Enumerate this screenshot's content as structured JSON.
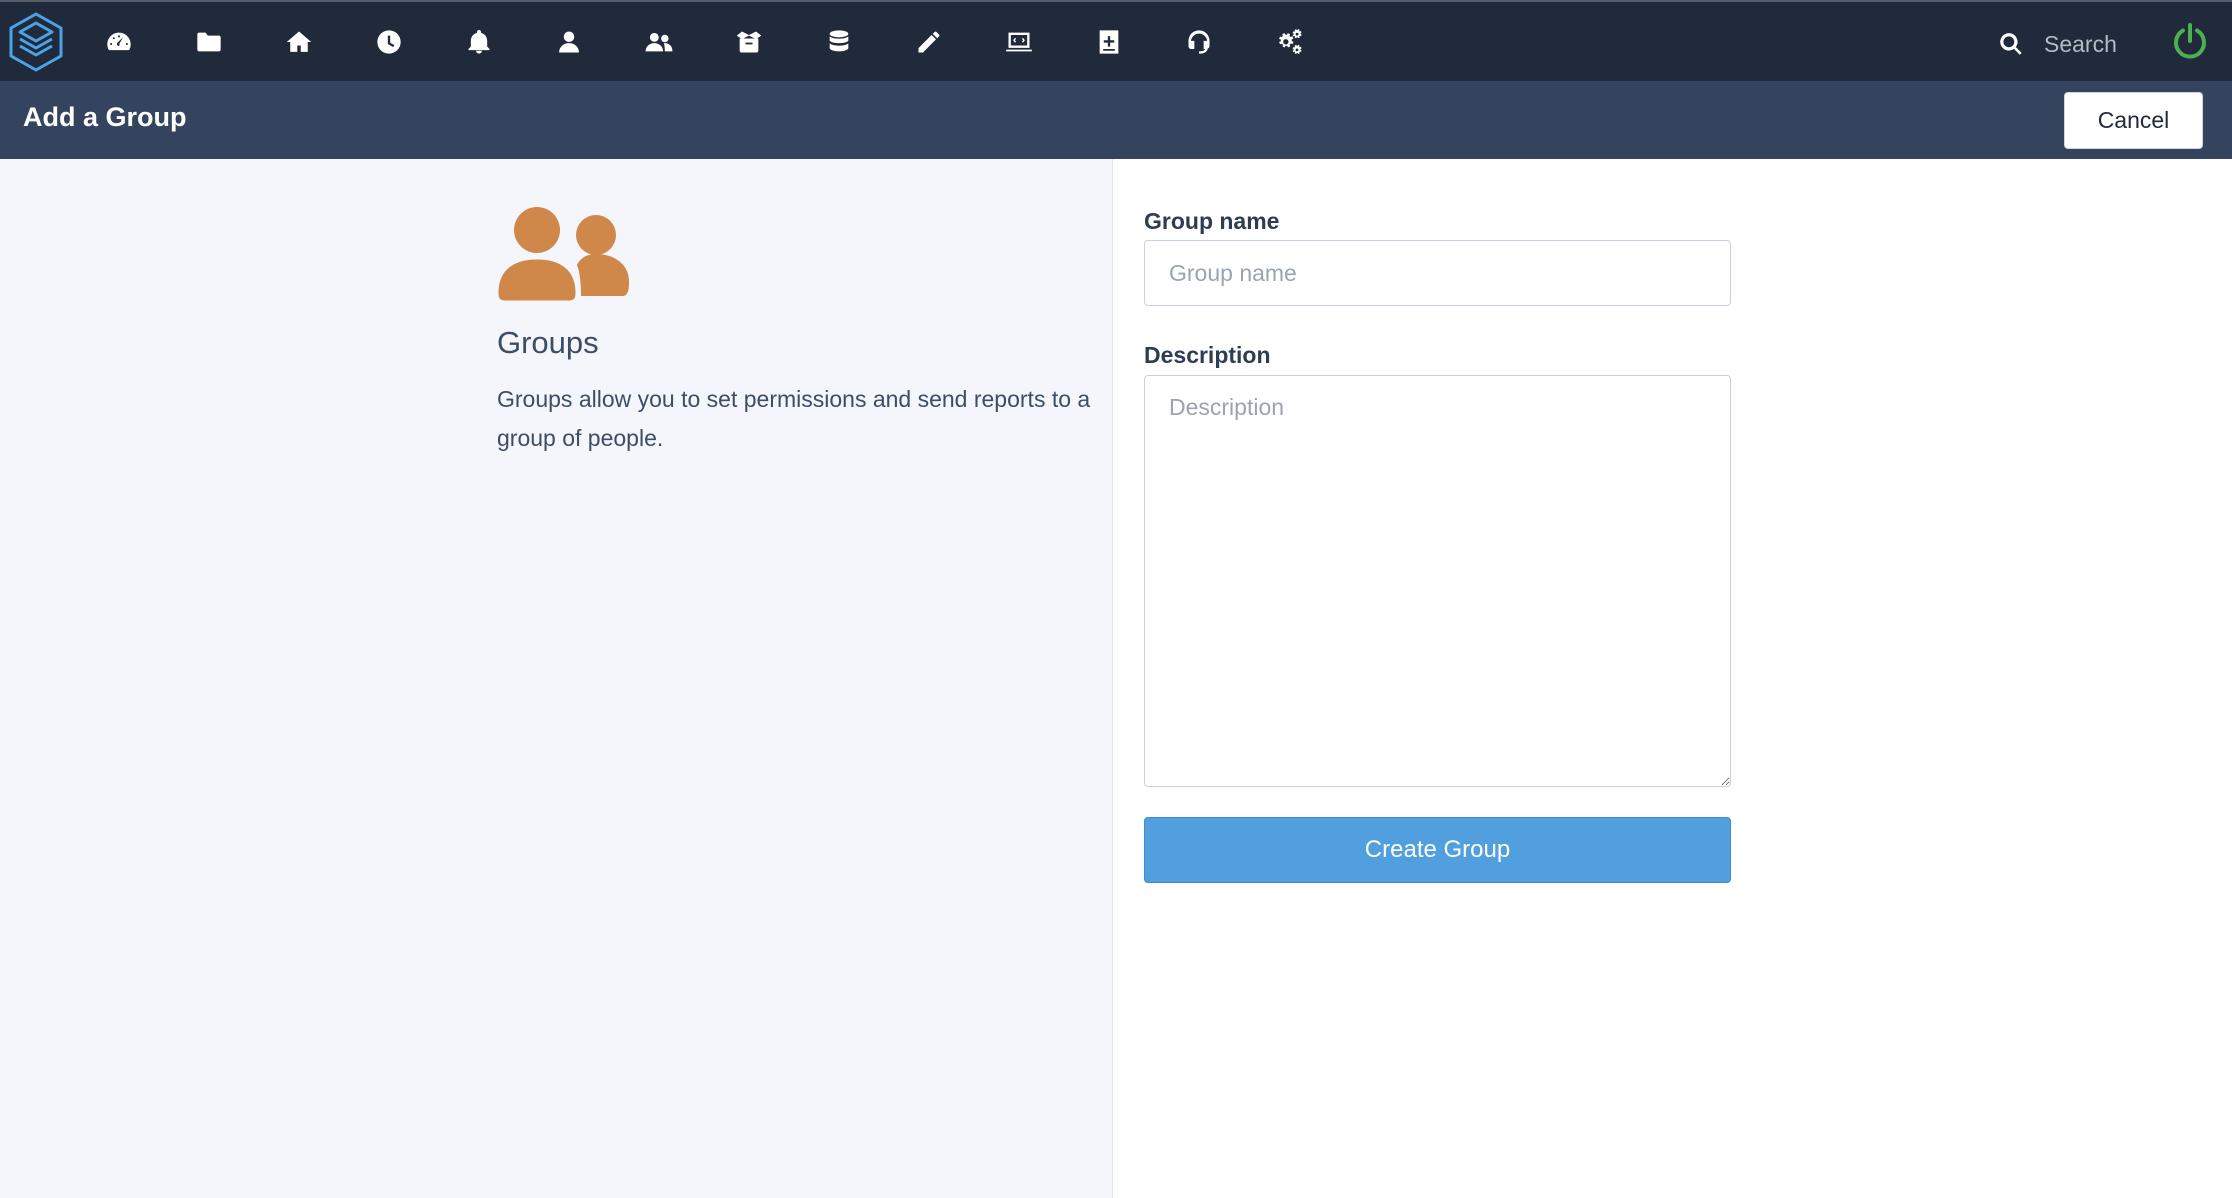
{
  "nav": {
    "icons": [
      "dashboard-icon",
      "folder-icon",
      "home-icon",
      "clock-icon",
      "bell-icon",
      "user-icon",
      "users-icon",
      "inbox-icon",
      "database-icon",
      "pencil-icon",
      "laptop-icon",
      "add-document-icon",
      "headset-icon",
      "cogs-icon"
    ],
    "search_label": "Search"
  },
  "header": {
    "title": "Add a Group",
    "cancel_label": "Cancel"
  },
  "info": {
    "heading": "Groups",
    "description": "Groups allow you to set permissions and send reports to a group of people."
  },
  "form": {
    "name_label": "Group name",
    "name_placeholder": "Group name",
    "description_label": "Description",
    "description_placeholder": "Description",
    "submit_label": "Create Group"
  },
  "colors": {
    "topbar": "#212a3a",
    "subheader": "#34445e",
    "accent": "#519fdf",
    "groups_icon": "#d0874a",
    "power": "#4caf50",
    "logo": "#4aa3e8"
  }
}
